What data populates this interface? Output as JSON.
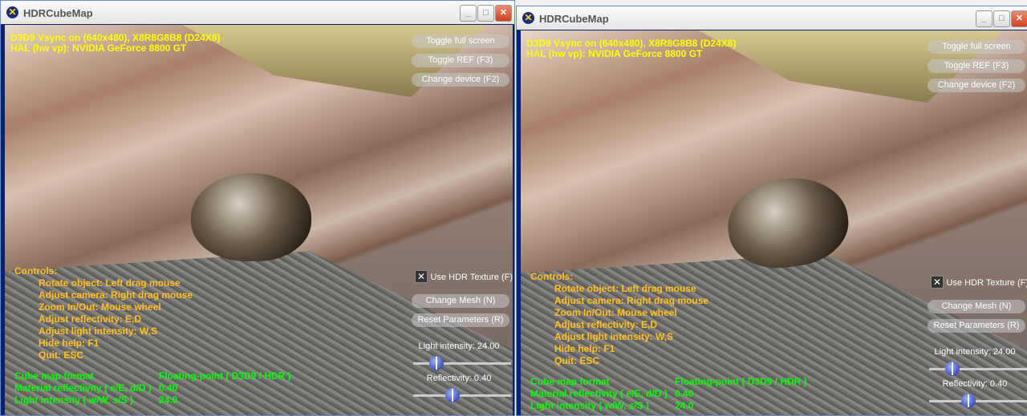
{
  "windows": [
    {
      "title": "HDRCubeMap",
      "device": "D3D9 Vsync on (640x480), X8R8G8B8 (D24X8)",
      "adapter": "HAL (hw vp): NVIDIA GeForce 8800 GT",
      "buttons": {
        "fullscreen": "Toggle full screen",
        "ref": "Toggle REF (F3)",
        "device": "Change device (F2)",
        "mesh": "Change Mesh (N)",
        "reset": "Reset Parameters (R)"
      },
      "hdr_checkbox": {
        "label": "Use HDR Texture (F)",
        "checked": true
      },
      "light_label": "Light intensity: 24.00",
      "light_value": 24.0,
      "reflect_label": "Reflectivity: 0.40",
      "reflect_value": 0.4,
      "controls": [
        "Controls:",
        "Rotate object: Left drag mouse",
        "Adjust camera: Right drag mouse",
        "Zoom In/Out: Mouse wheel",
        "Adjust reflectivity: E,D",
        "Adjust light intensity: W,S",
        "Hide help: F1",
        "Quit: ESC"
      ],
      "stats": [
        [
          "Cube map format",
          "Floating-point ( D3D9 / HDR )"
        ],
        [
          "Material reflectivity ( e/E, d/D )",
          "0.40"
        ],
        [
          "Light intensity ( w/W, s/S )",
          "24.0"
        ]
      ]
    },
    {
      "title": "HDRCubeMap",
      "device": "D3D9 Vsync on (640x480), X8R8G8B8 (D24X8)",
      "adapter": "HAL (hw vp): NVIDIA GeForce 8800 GT",
      "buttons": {
        "fullscreen": "Toggle full screen",
        "ref": "Toggle REF (F3)",
        "device": "Change device (F2)",
        "mesh": "Change Mesh (N)",
        "reset": "Reset Parameters (R)"
      },
      "hdr_checkbox": {
        "label": "Use HDR Texture (F)",
        "checked": true
      },
      "light_label": "Light intensity: 24.00",
      "light_value": 24.0,
      "reflect_label": "Reflectivity: 0.40",
      "reflect_value": 0.4,
      "controls": [
        "Controls:",
        "Rotate object: Left drag mouse",
        "Adjust camera: Right drag mouse",
        "Zoom In/Out: Mouse wheel",
        "Adjust reflectivity: E,D",
        "Adjust light intensity: W,S",
        "Hide help: F1",
        "Quit: ESC"
      ],
      "stats": [
        [
          "Cube map format",
          "Floating-point ( D3D9 / HDR )"
        ],
        [
          "Material reflectivity ( e/E, d/D )",
          "0.40"
        ],
        [
          "Light intensity ( w/W, s/S )",
          "24.0"
        ]
      ]
    }
  ],
  "icons": {
    "app": "directx-x-icon",
    "minimize": "minimize-icon",
    "maximize": "maximize-icon",
    "close": "close-icon"
  }
}
